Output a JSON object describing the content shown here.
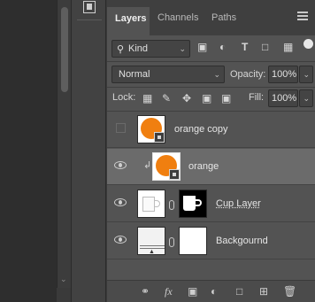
{
  "dock": {
    "icon": "panel-icon"
  },
  "tabs": {
    "layers": "Layers",
    "channels": "Channels",
    "paths": "Paths"
  },
  "filter": {
    "kind_label": "Kind",
    "icons": [
      "image-filter-icon",
      "adjustment-filter-icon",
      "type-filter-icon",
      "shape-filter-icon",
      "smart-object-filter-icon"
    ]
  },
  "blend": {
    "mode": "Normal",
    "opacity_label": "Opacity:",
    "opacity_value": "100%"
  },
  "lock": {
    "label": "Lock:",
    "fill_label": "Fill:",
    "fill_value": "100%"
  },
  "layers": [
    {
      "name": "orange copy",
      "visible": false,
      "selected": false,
      "type": "smart-object"
    },
    {
      "name": "orange",
      "visible": true,
      "selected": true,
      "type": "smart-object",
      "clipped": true
    },
    {
      "name": "Cup Layer",
      "visible": true,
      "selected": false,
      "type": "masked"
    },
    {
      "name": "Backgournd",
      "visible": true,
      "selected": false,
      "type": "masked"
    }
  ],
  "bottom_icons": [
    "link-layers-icon",
    "fx-icon",
    "add-mask-icon",
    "adjustment-layer-icon",
    "new-group-icon",
    "new-layer-icon",
    "delete-layer-icon"
  ],
  "bottom_fx_label": "fx"
}
